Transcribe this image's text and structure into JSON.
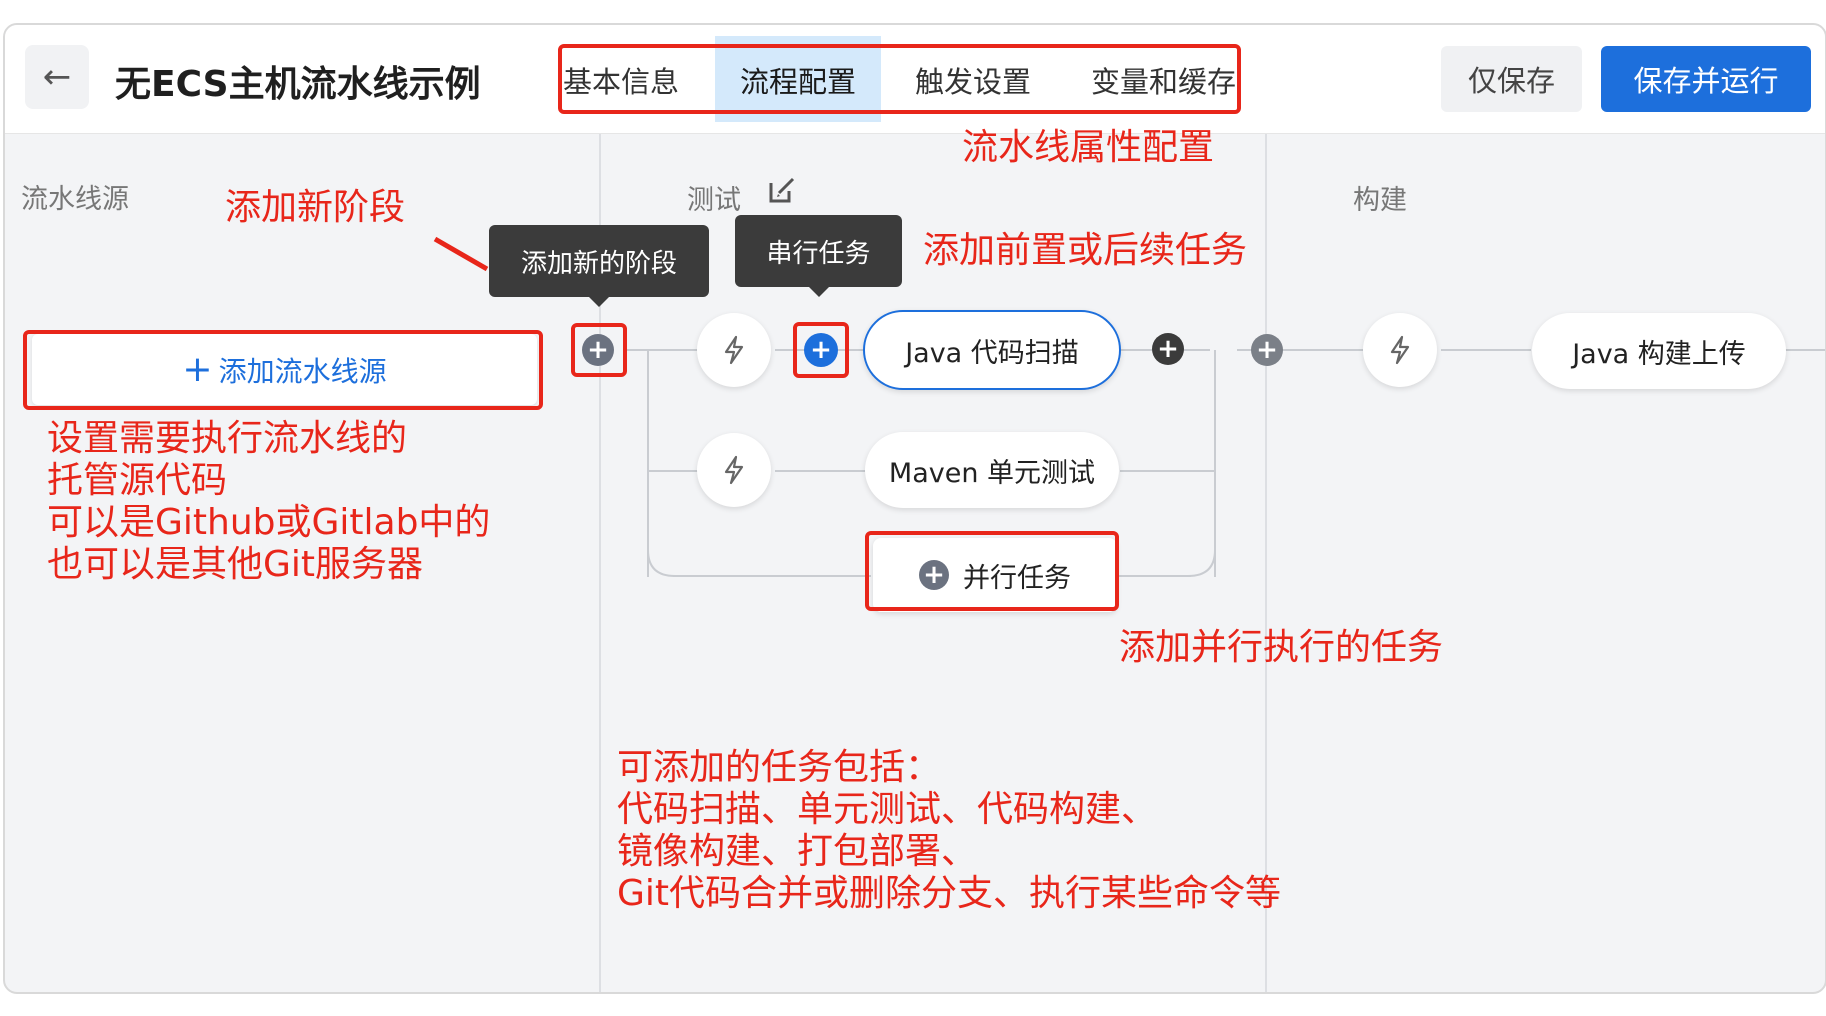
{
  "header": {
    "back_icon": "←",
    "title": "无ECS主机流水线示例",
    "tabs": [
      {
        "label": "基本信息"
      },
      {
        "label": "流程配置",
        "active": true
      },
      {
        "label": "触发设置"
      },
      {
        "label": "变量和缓存"
      }
    ],
    "save_label": "仅保存",
    "save_run_label": "保存并运行"
  },
  "stages": {
    "source": "流水线源",
    "test": "测试",
    "build": "构建"
  },
  "source": {
    "add_icon": "+",
    "add_label": "添加流水线源"
  },
  "tooltips": {
    "add_stage": "添加新的阶段",
    "serial_task": "串行任务"
  },
  "tasks": {
    "java_scan": "Java 代码扫描",
    "maven_test": "Maven 单元测试",
    "parallel": "并行任务",
    "java_build": "Java 构建上传"
  },
  "annotations": {
    "props": "流水线属性配置",
    "add_stage": "添加新阶段",
    "pre_post": "添加前置或后续任务",
    "source_lines": [
      "设置需要执行流水线的",
      "托管源代码",
      "可以是Github或Gitlab中的",
      "也可以是其他Git服务器"
    ],
    "parallel": "添加并行执行的任务",
    "tasks_lines": [
      "可添加的任务包括：",
      "代码扫描、单元测试、代码构建、",
      "镜像构建、打包部署、",
      "Git代码合并或删除分支、执行某些命令等"
    ]
  },
  "icons": {
    "back": "arrow-left-icon",
    "edit": "edit-icon",
    "bolt": "lightning-icon",
    "plus": "plus-circle-icon"
  },
  "colors": {
    "accent": "#1d6fdc",
    "annotation": "#e8261a",
    "tooltip": "#3b3b3b",
    "active_tab": "#d4e9fb"
  }
}
